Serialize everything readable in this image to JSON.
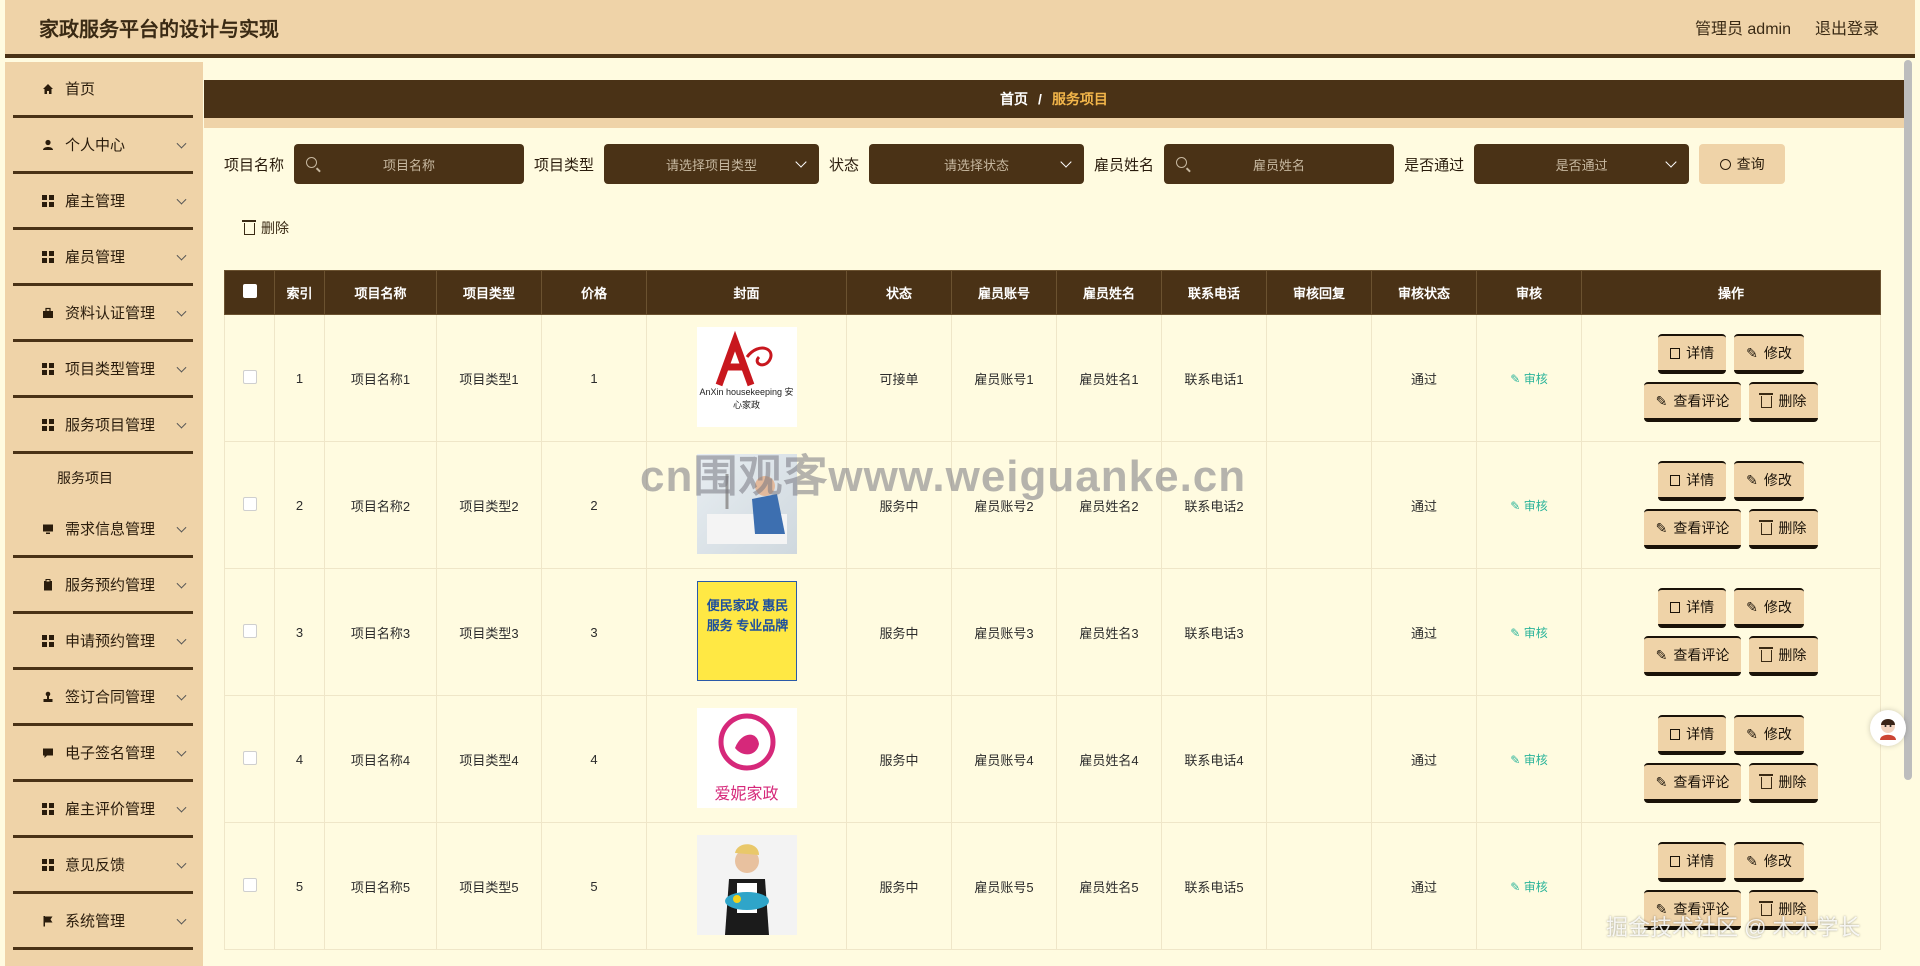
{
  "header": {
    "title": "家政服务平台的设计与实现",
    "admin_label": "管理员 admin",
    "logout_label": "退出登录"
  },
  "sidebar": {
    "items": [
      {
        "label": "首页",
        "icon": "home-icon"
      },
      {
        "label": "个人中心",
        "icon": "user-icon"
      },
      {
        "label": "雇主管理",
        "icon": "grid-icon"
      },
      {
        "label": "雇员管理",
        "icon": "grid-icon"
      },
      {
        "label": "资料认证管理",
        "icon": "briefcase-icon"
      },
      {
        "label": "项目类型管理",
        "icon": "grid-icon"
      },
      {
        "label": "服务项目管理",
        "icon": "grid-icon"
      },
      {
        "label": "需求信息管理",
        "icon": "monitor-icon"
      },
      {
        "label": "服务预约管理",
        "icon": "clipboard-icon"
      },
      {
        "label": "申请预约管理",
        "icon": "grid-icon"
      },
      {
        "label": "签订合同管理",
        "icon": "stamp-icon"
      },
      {
        "label": "电子签名管理",
        "icon": "chat-icon"
      },
      {
        "label": "雇主评价管理",
        "icon": "grid-icon"
      },
      {
        "label": "意见反馈",
        "icon": "grid-icon"
      },
      {
        "label": "系统管理",
        "icon": "flag-icon"
      }
    ],
    "sub_item": "服务项目"
  },
  "breadcrumb": {
    "home": "首页",
    "separator": "/",
    "current": "服务项目"
  },
  "search": {
    "name_label": "项目名称",
    "name_placeholder": "项目名称",
    "type_label": "项目类型",
    "type_placeholder": "请选择项目类型",
    "status_label": "状态",
    "status_placeholder": "请选择状态",
    "employee_label": "雇员姓名",
    "employee_placeholder": "雇员姓名",
    "passed_label": "是否通过",
    "passed_placeholder": "是否通过",
    "query_button": "查询"
  },
  "toolbar": {
    "delete_label": "删除"
  },
  "table": {
    "headers": [
      "索引",
      "项目名称",
      "项目类型",
      "价格",
      "封面",
      "状态",
      "雇员账号",
      "雇员姓名",
      "联系电话",
      "审核回复",
      "审核状态",
      "审核",
      "操作"
    ],
    "rows": [
      {
        "index": "1",
        "name": "项目名称1",
        "type": "项目类型1",
        "price": "1",
        "cover_text": "AnXin housekeeping 安心家政",
        "status": "可接单",
        "account": "雇员账号1",
        "employee": "雇员姓名1",
        "phone": "联系电话1",
        "reply": "",
        "audit_status": "通过",
        "audit": "审核"
      },
      {
        "index": "2",
        "name": "项目名称2",
        "type": "项目类型2",
        "price": "2",
        "cover_text": "",
        "status": "服务中",
        "account": "雇员账号2",
        "employee": "雇员姓名2",
        "phone": "联系电话2",
        "reply": "",
        "audit_status": "通过",
        "audit": "审核"
      },
      {
        "index": "3",
        "name": "项目名称3",
        "type": "项目类型3",
        "price": "3",
        "cover_text": "便民家政 惠民服务 专业品牌",
        "status": "服务中",
        "account": "雇员账号3",
        "employee": "雇员姓名3",
        "phone": "联系电话3",
        "reply": "",
        "audit_status": "通过",
        "audit": "审核"
      },
      {
        "index": "4",
        "name": "项目名称4",
        "type": "项目类型4",
        "price": "4",
        "cover_text": "爱妮家政",
        "status": "服务中",
        "account": "雇员账号4",
        "employee": "雇员姓名4",
        "phone": "联系电话4",
        "reply": "",
        "audit_status": "通过",
        "audit": "审核"
      },
      {
        "index": "5",
        "name": "项目名称5",
        "type": "项目类型5",
        "price": "5",
        "cover_text": "",
        "status": "服务中",
        "account": "雇员账号5",
        "employee": "雇员姓名5",
        "phone": "联系电话5",
        "reply": "",
        "audit_status": "通过",
        "audit": "审核"
      }
    ],
    "actions": {
      "detail": "详情",
      "edit": "修改",
      "comments": "查看评论",
      "delete": "删除"
    }
  },
  "watermarks": {
    "center": "cn围观客www.weiguanke.cn",
    "corner": "掘金技术社区 @ 木木学长"
  },
  "colors": {
    "primary_dark": "#4a3216",
    "accent_tan": "#efd3a8",
    "background": "#fffbe0",
    "breadcrumb_active": "#f3b64a",
    "audit_link": "#2bb49a"
  }
}
